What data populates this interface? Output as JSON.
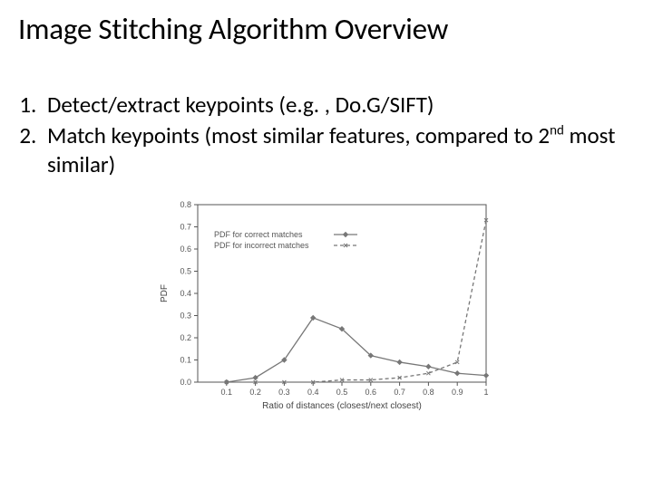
{
  "title": "Image Stitching Algorithm Overview",
  "points": {
    "item1_a": "Detect/extract keypoints (e.g. , Do.G/SIFT)",
    "item2_a": "Match keypoints (most similar features, compared to 2",
    "item2_sup": "nd",
    "item2_b": " most similar)"
  },
  "chart_data": {
    "type": "line",
    "title": "",
    "xlabel": "Ratio of distances (closest/next closest)",
    "ylabel": "PDF",
    "xlim": [
      0,
      1
    ],
    "ylim": [
      0,
      0.8
    ],
    "xticks": [
      0.1,
      0.2,
      0.3,
      0.4,
      0.5,
      0.6,
      0.7,
      0.8,
      0.9,
      1
    ],
    "yticks": [
      0,
      0.1,
      0.2,
      0.3,
      0.4,
      0.5,
      0.6,
      0.7,
      0.8
    ],
    "legend": {
      "correct": "PDF for correct matches",
      "incorrect": "PDF for incorrect matches"
    },
    "series": [
      {
        "name": "correct",
        "style": "solid",
        "x": [
          0.1,
          0.2,
          0.3,
          0.4,
          0.5,
          0.6,
          0.7,
          0.8,
          0.9,
          1.0
        ],
        "y": [
          0.0,
          0.02,
          0.1,
          0.29,
          0.24,
          0.12,
          0.09,
          0.07,
          0.04,
          0.03
        ]
      },
      {
        "name": "incorrect",
        "style": "dashed",
        "x": [
          0.1,
          0.2,
          0.3,
          0.4,
          0.5,
          0.6,
          0.7,
          0.8,
          0.9,
          1.0
        ],
        "y": [
          0.0,
          0.0,
          0.0,
          0.0,
          0.01,
          0.01,
          0.02,
          0.04,
          0.09,
          0.73
        ]
      }
    ]
  }
}
